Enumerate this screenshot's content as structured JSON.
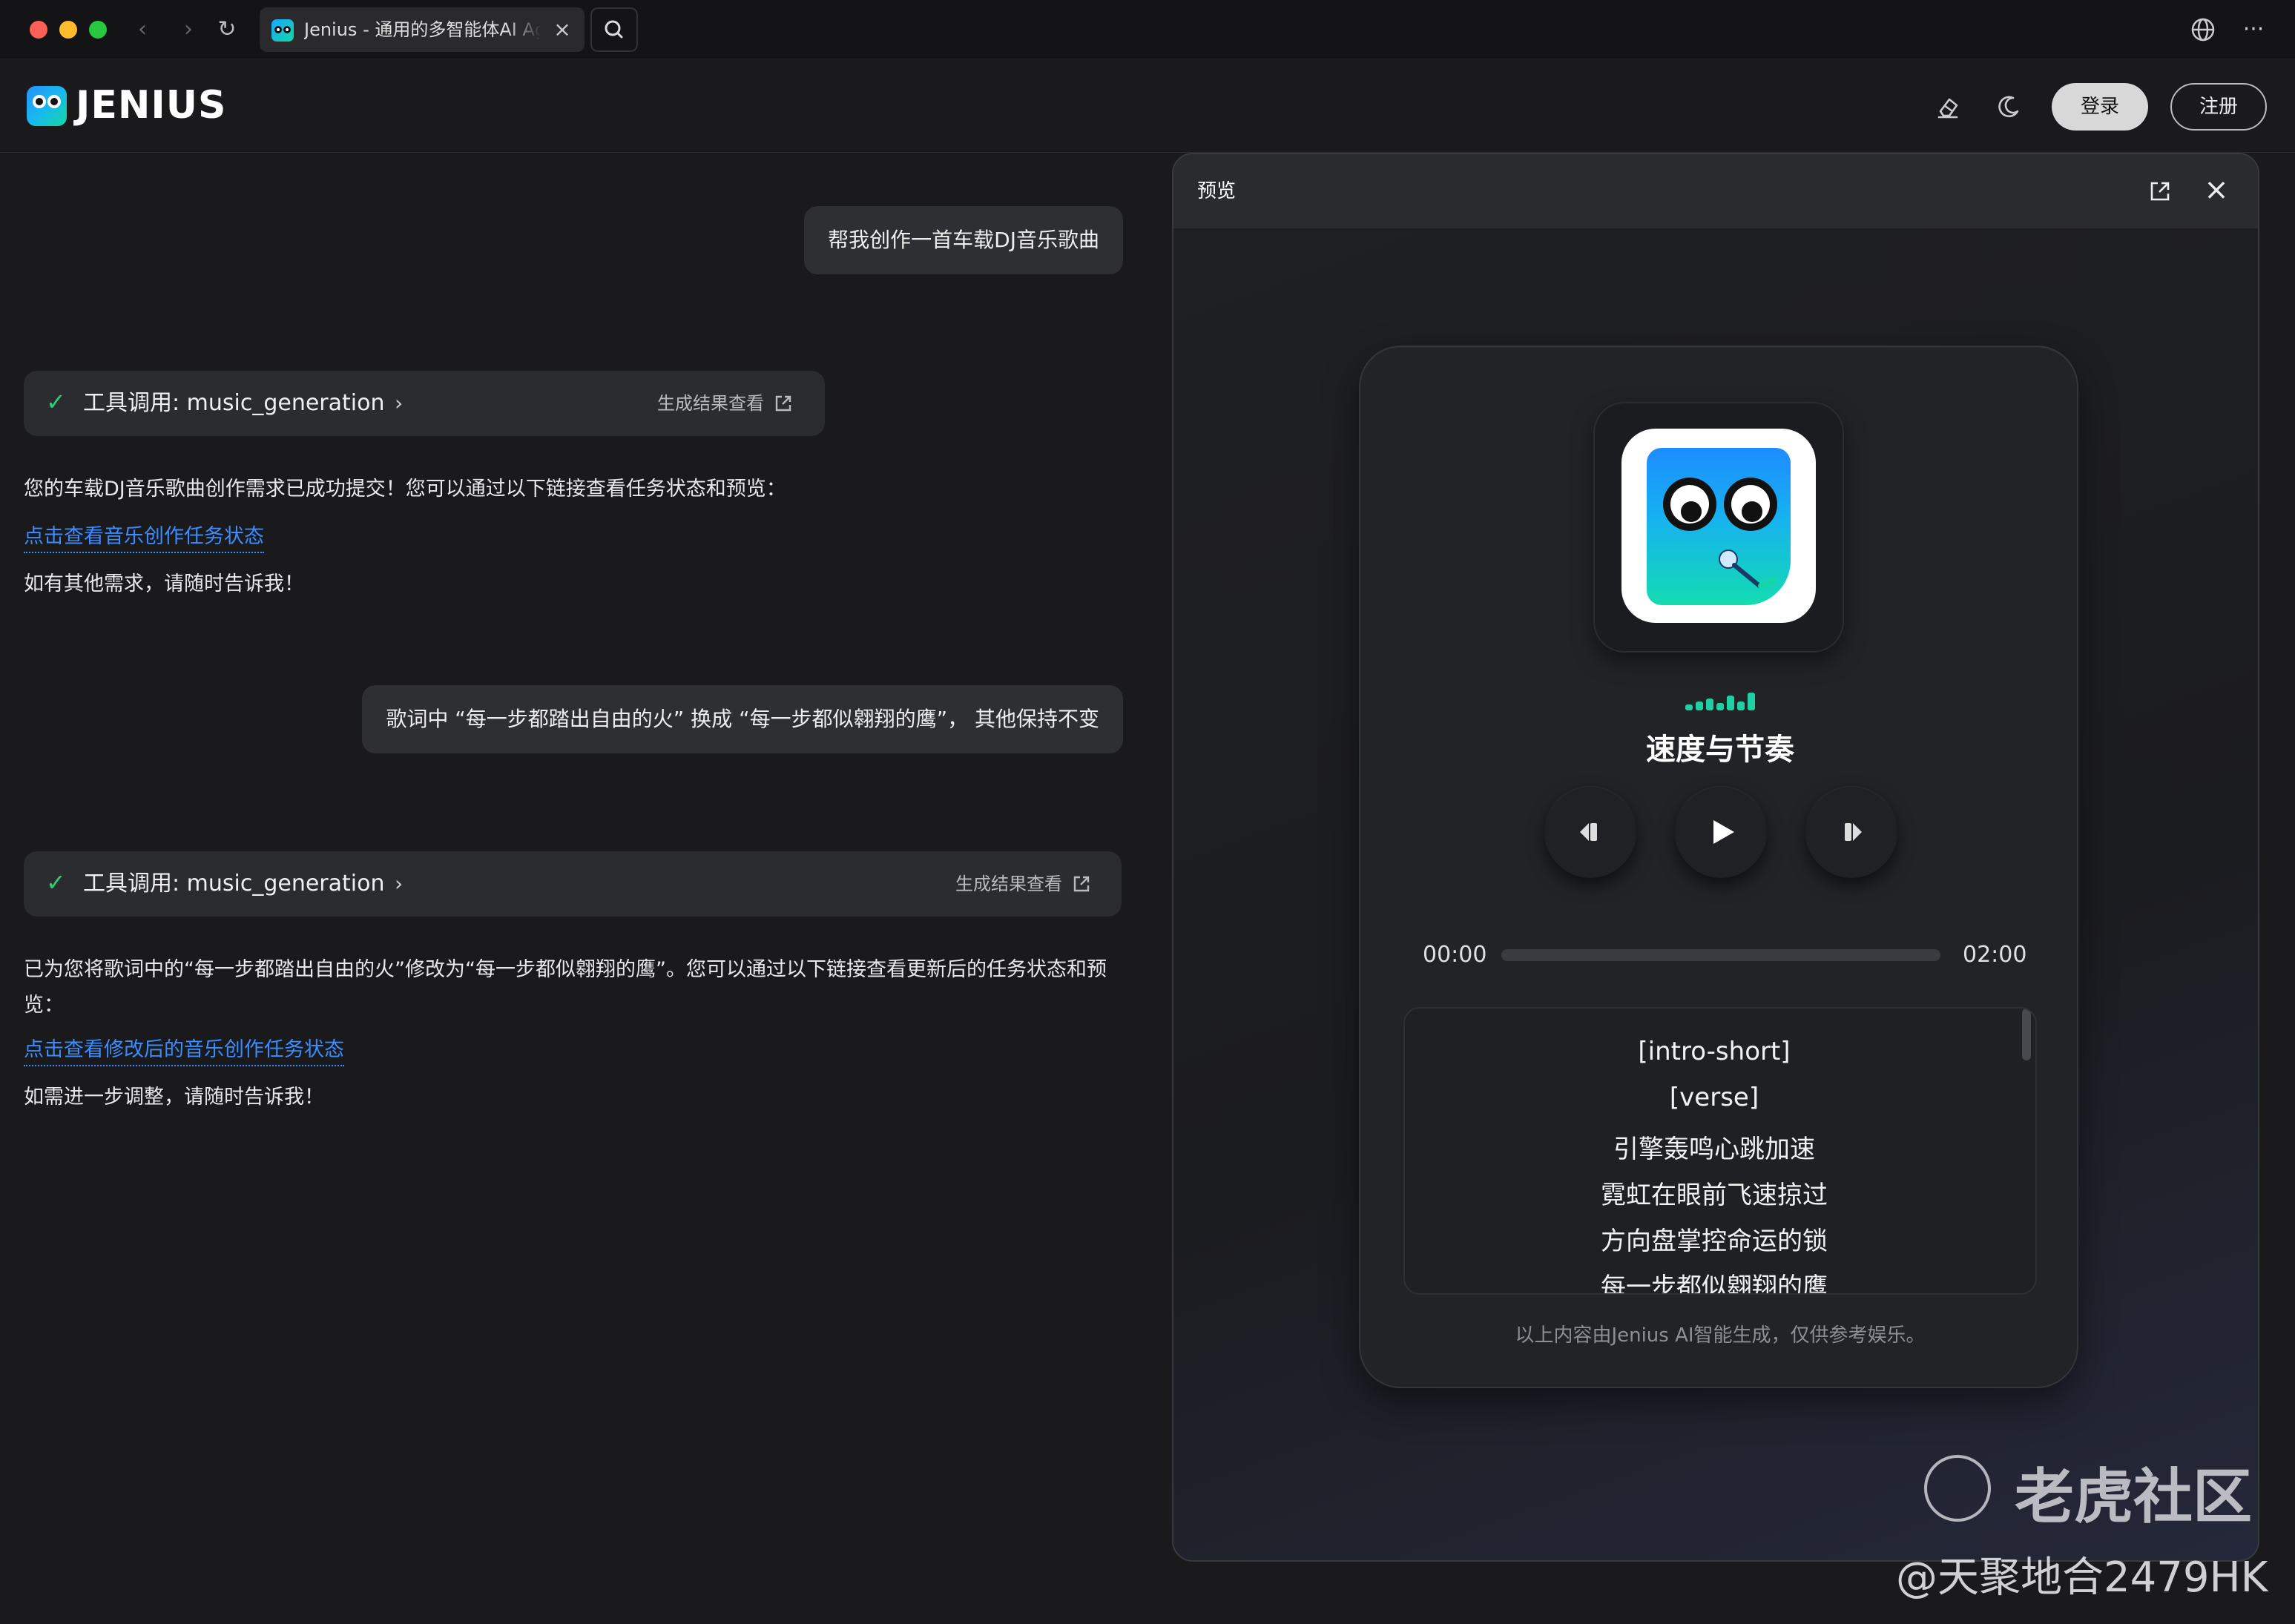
{
  "browser": {
    "tab_title": "Jenius - 通用的多智能体AI Agent",
    "tab_close": "×",
    "nav_back": "‹",
    "nav_forward": "›",
    "reload": "↻",
    "menu": "···"
  },
  "header": {
    "brand": "JENIUS",
    "login_label": "登录",
    "register_label": "注册"
  },
  "chat": {
    "messages": [
      {
        "role": "user",
        "text": "帮我创作一首车载DJ音乐歌曲"
      },
      {
        "role": "tool",
        "label": "工具调用: music_generation",
        "view_label": "生成结果查看"
      },
      {
        "role": "assistant",
        "text": "您的车载DJ音乐歌曲创作需求已成功提交！您可以通过以下链接查看任务状态和预览：",
        "link": "点击查看音乐创作任务状态",
        "footer": "如有其他需求，请随时告诉我！"
      },
      {
        "role": "user",
        "text": "歌词中 “每一步都踏出自由的火” 换成 “每一步都似翱翔的鹰”，  其他保持不变"
      },
      {
        "role": "tool",
        "label": "工具调用: music_generation",
        "view_label": "生成结果查看"
      },
      {
        "role": "assistant",
        "text": "已为您将歌词中的“每一步都踏出自由的火”修改为“每一步都似翱翔的鹰”。您可以通过以下链接查看更新后的任务状态和预览：",
        "link": "点击查看修改后的音乐创作任务状态",
        "footer": "如需进一步调整，请随时告诉我！"
      }
    ]
  },
  "preview": {
    "title": "预览",
    "close": "×",
    "player": {
      "song_title": "速度与节奏",
      "time_current": "00:00",
      "time_total": "02:00",
      "progress": 0,
      "lyrics": [
        "[intro-short]",
        "[verse]",
        "引擎轰鸣心跳加速",
        "霓虹在眼前飞速掠过",
        "方向盘掌控命运的锁",
        "每一步都似翱翔的鹰"
      ],
      "disclaimer": "以上内容由Jenius AI智能生成，仅供参考娱乐。"
    }
  },
  "watermark": {
    "site": "老虎社区",
    "handle": "@天聚地合2479HK"
  },
  "colors": {
    "accent_green": "#2fd070",
    "link_blue": "#3b8dff",
    "eq_teal": "#1fd0a4"
  }
}
